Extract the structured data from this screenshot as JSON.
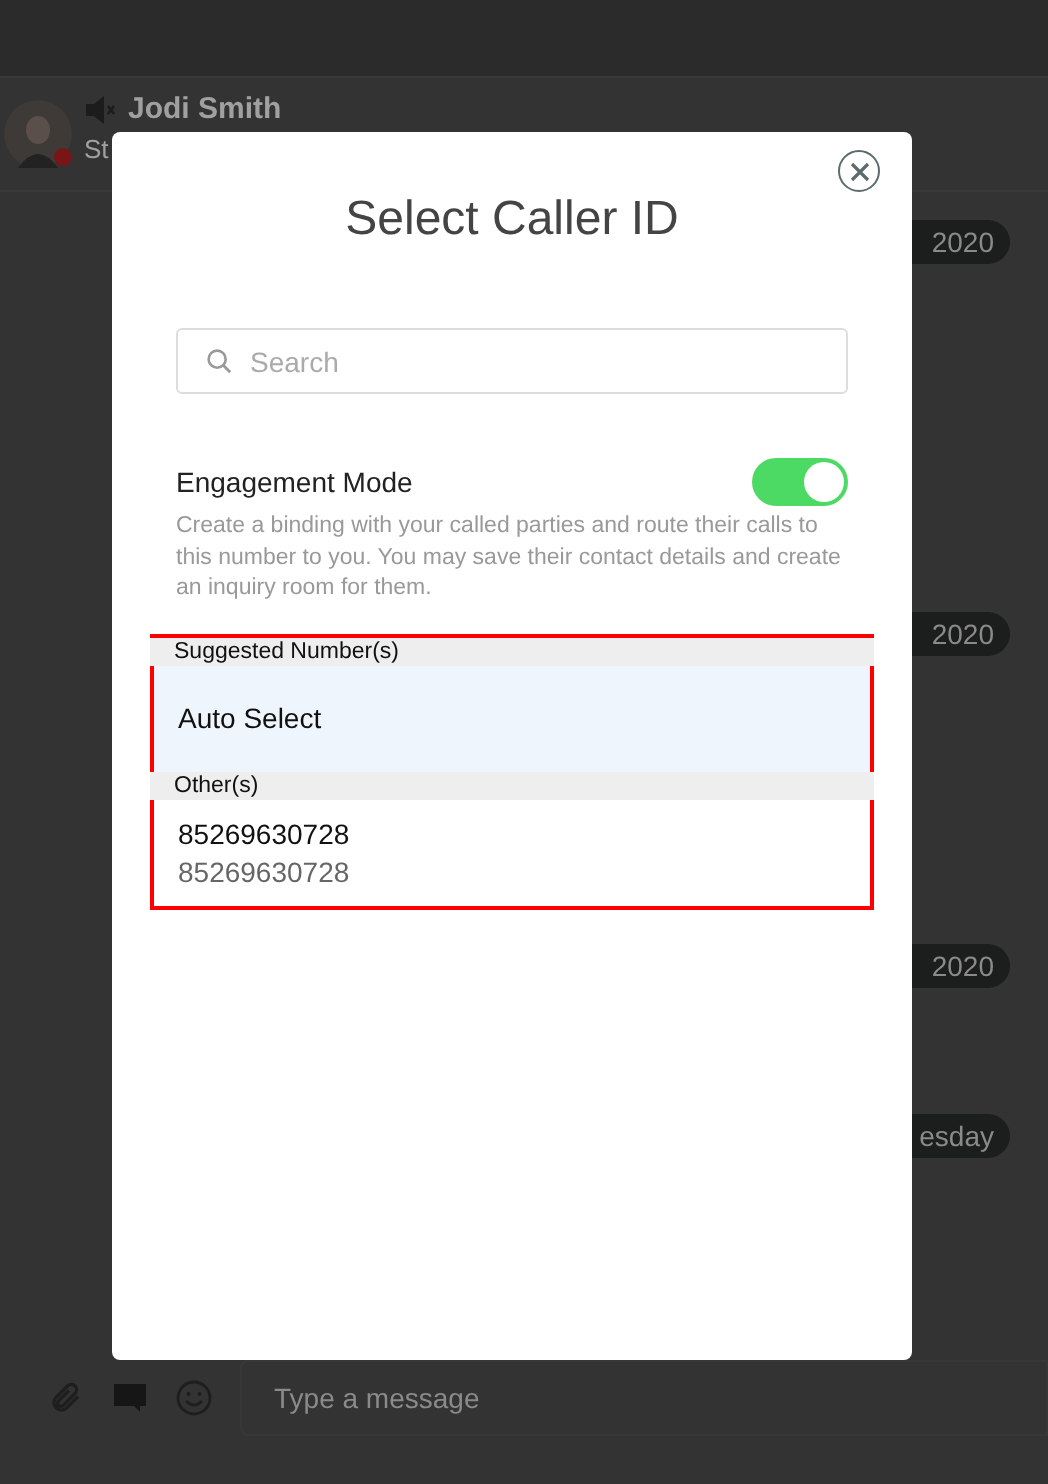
{
  "chat": {
    "contact": {
      "name": "Jodi Smith",
      "status": "St",
      "online": false
    },
    "date_pills": [
      "2020",
      "2020",
      "2020",
      "esday"
    ],
    "composer": {
      "placeholder": "Type a message"
    }
  },
  "dialog": {
    "title": "Select Caller ID",
    "search": {
      "placeholder": "Search"
    },
    "engagement": {
      "label": "Engagement Mode",
      "on": true,
      "description": "Create a binding with your called parties and route their calls to this number to you. You may save their contact details and create an inquiry room for them."
    },
    "sections": [
      {
        "header": "Suggested Number(s)",
        "items": [
          {
            "title": "Auto Select",
            "selected": true
          }
        ]
      },
      {
        "header": "Other(s)",
        "items": [
          {
            "title": "85269630728",
            "subtitle": "85269630728",
            "selected": false
          }
        ]
      }
    ]
  }
}
